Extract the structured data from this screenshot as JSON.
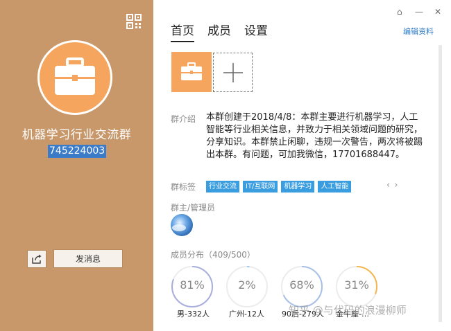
{
  "left": {
    "group_name": "机器学习行业交流群",
    "group_id": "745224003",
    "send_message_label": "发消息"
  },
  "right": {
    "tabs": [
      {
        "label": "首页",
        "active": true
      },
      {
        "label": "成员",
        "active": false
      },
      {
        "label": "设置",
        "active": false
      }
    ],
    "edit_label": "编辑资料",
    "window_controls": {
      "home": "⌂",
      "minimize": "—",
      "close": "✕"
    },
    "intro_label": "群介绍",
    "intro_text": "本群创建于2018/4/8：本群主要进行机器学习，人工智能等行业相关信息，并致力于相关领域问题的研究，分享知识。本群禁止闲聊，违规一次警告，两次将被踢出本群。有问题，可加我微信，17701688447。",
    "tags_label": "群标签",
    "tags": [
      "行业交流",
      "IT/互联网",
      "机器学习",
      "人工智能"
    ],
    "admin_label": "群主/管理员",
    "distribution_label": "成员分布（409/500）",
    "stats": [
      {
        "percent": "81%",
        "value": 81,
        "caption": "男-332人",
        "color": "#a8aedd"
      },
      {
        "percent": "2%",
        "value": 2,
        "caption": "广州-12人",
        "color": "#a6c8ec"
      },
      {
        "percent": "68%",
        "value": 68,
        "caption": "90后-279人",
        "color": "#a7c0e7"
      },
      {
        "percent": "31%",
        "value": 31,
        "caption": "金牛座-…",
        "color": "#f3b74f"
      }
    ],
    "watermark": "知乎 @与代码的浪漫柳师"
  },
  "icons": [
    "qr-code-icon",
    "briefcase-icon",
    "share-icon",
    "plus-icon",
    "chevron-left-icon",
    "chevron-right-icon",
    "home-icon",
    "minimize-icon",
    "close-icon"
  ],
  "colors": {
    "left_bg": "#c8986a",
    "accent_orange": "#f5a55d",
    "link_blue": "#2f7cc7",
    "tag_blue": "#3a9de0"
  }
}
